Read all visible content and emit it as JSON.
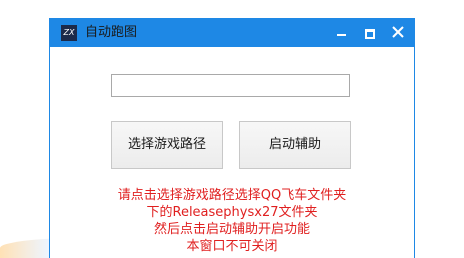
{
  "window": {
    "title": "自动跑图",
    "app_icon_text": "ZX"
  },
  "path_input": {
    "value": "",
    "placeholder": ""
  },
  "buttons": {
    "select_game_path": "选择游戏路径",
    "start_assist": "启动辅助"
  },
  "instructions": {
    "line1": "请点击选择游戏路径选择QQ飞车文件夹",
    "line2": "下的Releasephysx27文件夹",
    "line3": "然后点击启动辅助开启功能",
    "line4": "本窗口不可关闭"
  },
  "colors": {
    "titlebar": "#1e88e5",
    "instruction_text": "#e02020"
  }
}
